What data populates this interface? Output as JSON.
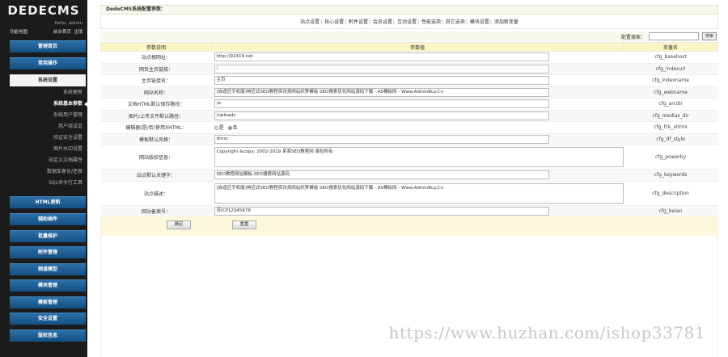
{
  "sidebar": {
    "logo": "DEDECMS",
    "hello": "Hello, admin",
    "user_links": [
      "功能地图",
      "前台首页",
      "注销"
    ],
    "nav": [
      {
        "label": "管理首页"
      },
      {
        "label": "常用操作"
      },
      {
        "label": "系统设置"
      },
      {
        "label": "HTML更新"
      },
      {
        "label": "辅助插件"
      },
      {
        "label": "批量维护"
      },
      {
        "label": "附件管理"
      },
      {
        "label": "频道模型"
      },
      {
        "label": "模块管理"
      },
      {
        "label": "模板管理"
      },
      {
        "label": "安全设置"
      },
      {
        "label": "版权信息"
      }
    ],
    "subitems": [
      "系统更新",
      "系统基本参数",
      "系统用户管理",
      "用户组设定",
      "验证安全设置",
      "图片水印设置",
      "自定义文档属性",
      "数据库备份/还原",
      "SQL命令行工具"
    ]
  },
  "main": {
    "title": "DedeCMS系统配置参数：",
    "tabs": [
      "站点设置",
      "核心设置",
      "附件设置",
      "会员设置",
      "互动设置",
      "性能选项",
      "其它选项",
      "模块设置",
      "添加新变量"
    ],
    "search_label": "配置搜索：",
    "search_value": "",
    "search_button": "搜索",
    "columns": [
      "参数说明",
      "参数值",
      "变量名"
    ],
    "rows": [
      {
        "label": "站点根网址：",
        "value": "http://92419.net",
        "var": "cfg_basehost",
        "type": "text"
      },
      {
        "label": "网页主页链接：",
        "value": "/",
        "var": "cfg_indexurl",
        "type": "text"
      },
      {
        "label": "主页链接名：",
        "value": "主页",
        "var": "cfg_indexname",
        "type": "text"
      },
      {
        "label": "网站名称：",
        "value": "[自适应手机版]响应式SEO教程资讯类网站织梦模板 SEO搜索优化网站源码下载 - A5模板网 - Www.AdminBuy.Cn",
        "var": "cfg_webname",
        "type": "text"
      },
      {
        "label": "文档HTML默认保存路径：",
        "value": "/a",
        "var": "cfg_arcdir",
        "type": "text"
      },
      {
        "label": "图片/上传文件默认路径：",
        "value": "/uploads",
        "var": "cfg_medias_dir",
        "type": "text"
      },
      {
        "label": "编辑器(是/否)使用XHTML：",
        "radio_no": "是",
        "radio_yes": "否",
        "var": "cfg_fck_xhtml",
        "type": "radio"
      },
      {
        "label": "模板默认风格：",
        "value": "dmsc",
        "var": "cfg_df_style",
        "type": "text"
      },
      {
        "label": "网站版权信息：",
        "value": "Copyright &copy; 2002-2019 某某SEO教程网 版权所有",
        "var": "cfg_powerby",
        "type": "area"
      },
      {
        "label": "站点默认关键字：",
        "value": "SEO教程网站模板,SEO搜索网站源码",
        "var": "cfg_keywords",
        "type": "text"
      },
      {
        "label": "站点描述：",
        "value": "[自适应手机版]响应式SEO教程资讯类网站织梦模板 SEO搜索优化网站源码下载 - A5模板网 - Www.AdminBuy.Cn",
        "var": "cfg_description",
        "type": "area"
      },
      {
        "label": "网站备案号：",
        "value": "苏ICP12345678",
        "var": "cfg_beian",
        "type": "text"
      }
    ],
    "confirm_button": "确定",
    "reset_button": "重置"
  },
  "watermark": "https://www.huzhan.com/ishop33781"
}
